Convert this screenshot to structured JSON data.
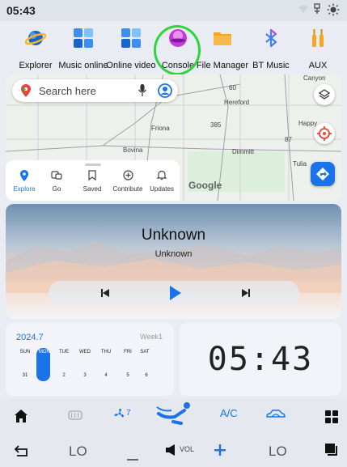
{
  "status": {
    "time": "05:43"
  },
  "apps": [
    {
      "label": "Explorer",
      "icon": "planet-icon"
    },
    {
      "label": "Music online",
      "icon": "app-grid-icon"
    },
    {
      "label": "Online video",
      "icon": "app-grid-icon"
    },
    {
      "label": "Console",
      "icon": "console-orb-icon"
    },
    {
      "label": "File Manager",
      "icon": "folder-icon"
    },
    {
      "label": "BT Music",
      "icon": "bluetooth-icon"
    },
    {
      "label": "AUX",
      "icon": "aux-plug-icon"
    }
  ],
  "map": {
    "search_placeholder": "Search here",
    "labels": [
      "Canyon",
      "Hereford",
      "Friona",
      "Happy",
      "Bovina",
      "Dimmitt",
      "Tulia",
      "385",
      "87",
      "60"
    ],
    "google": "Google",
    "nav": [
      {
        "label": "Explore",
        "icon": "location-pin-icon"
      },
      {
        "label": "Go",
        "icon": "commute-icon"
      },
      {
        "label": "Saved",
        "icon": "bookmark-icon"
      },
      {
        "label": "Contribute",
        "icon": "add-circle-icon"
      },
      {
        "label": "Updates",
        "icon": "bell-icon"
      }
    ]
  },
  "music": {
    "title": "Unknown",
    "artist": "Unknown"
  },
  "calendar": {
    "month": "2024.7",
    "week": "Week1",
    "days": [
      "SUN",
      "MON",
      "TUE",
      "WED",
      "THU",
      "FRI",
      "SAT"
    ],
    "dates": [
      "31",
      "1",
      "2",
      "3",
      "4",
      "5",
      "6"
    ],
    "today_index": 1
  },
  "clock": {
    "time": "05:43"
  },
  "climate": {
    "fan_level": "7",
    "ac": "A/C",
    "left_temp": "LO",
    "right_temp": "LO",
    "vol": "VOL"
  },
  "colors": {
    "accent": "#1a73e8",
    "highlight": "#2fd33a"
  }
}
